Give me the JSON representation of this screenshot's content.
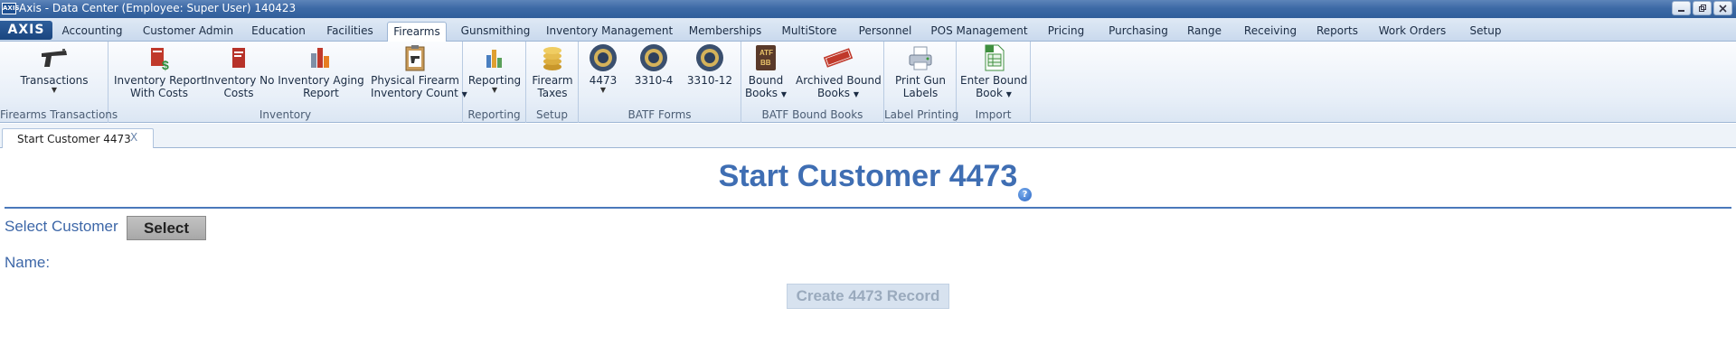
{
  "window": {
    "title": "Axis - Data Center  (Employee: Super User) 140423",
    "logo_text": "AXIS"
  },
  "menu": {
    "logo": "AXIS",
    "tabs": [
      {
        "label": "Accounting"
      },
      {
        "label": "Customer Admin"
      },
      {
        "label": "Education"
      },
      {
        "label": "Facilities"
      },
      {
        "label": "Firearms",
        "active": true
      },
      {
        "label": "Gunsmithing"
      },
      {
        "label": "Inventory Management"
      },
      {
        "label": "Memberships"
      },
      {
        "label": "MultiStore"
      },
      {
        "label": "Personnel"
      },
      {
        "label": "POS Management"
      },
      {
        "label": "Pricing"
      },
      {
        "label": "Purchasing"
      },
      {
        "label": "Range"
      },
      {
        "label": "Receiving"
      },
      {
        "label": "Reports"
      },
      {
        "label": "Work Orders"
      },
      {
        "label": "Setup"
      }
    ]
  },
  "ribbon": {
    "groups": {
      "firearms_transactions": {
        "label": "Firearms Transactions",
        "buttons": {
          "transactions": "Transactions"
        }
      },
      "inventory": {
        "label": "Inventory",
        "buttons": {
          "inv_report_costs_1": "Inventory Report",
          "inv_report_costs_2": "With Costs",
          "inv_no_costs_1": "Inventory No",
          "inv_no_costs_2": "Costs",
          "inv_aging_1": "Inventory Aging",
          "inv_aging_2": "Report",
          "physical_count_1": "Physical Firearm",
          "physical_count_2": "Inventory Count"
        }
      },
      "reporting": {
        "label": "Reporting",
        "buttons": {
          "reporting": "Reporting"
        }
      },
      "setup": {
        "label": "Setup",
        "buttons": {
          "taxes_1": "Firearm",
          "taxes_2": "Taxes"
        }
      },
      "batf_forms": {
        "label": "BATF Forms",
        "buttons": {
          "f4473": "4473",
          "f3310_4": "3310-4",
          "f3310_12": "3310-12"
        }
      },
      "batf_bound_books": {
        "label": "BATF Bound Books",
        "buttons": {
          "bound_1": "Bound",
          "bound_2": "Books",
          "archived_1": "Archived Bound",
          "archived_2": "Books"
        }
      },
      "label_printing": {
        "label": "Label Printing",
        "buttons": {
          "print_1": "Print Gun",
          "print_2": "Labels"
        }
      },
      "import": {
        "label": "Import",
        "buttons": {
          "enter_1": "Enter Bound",
          "enter_2": "Book"
        }
      }
    }
  },
  "doc_tabs": [
    {
      "label": "Start Customer 4473",
      "close": "X"
    }
  ],
  "main": {
    "heading": "Start Customer 4473",
    "help": "?",
    "select_customer_label": "Select Customer",
    "select_button": "Select",
    "name_label": "Name:",
    "create_button": "Create 4473 Record"
  },
  "colors": {
    "accent": "#3f6eb3",
    "titlebar": "#3d6aa6",
    "disabled_button": "#d7e2ef"
  }
}
